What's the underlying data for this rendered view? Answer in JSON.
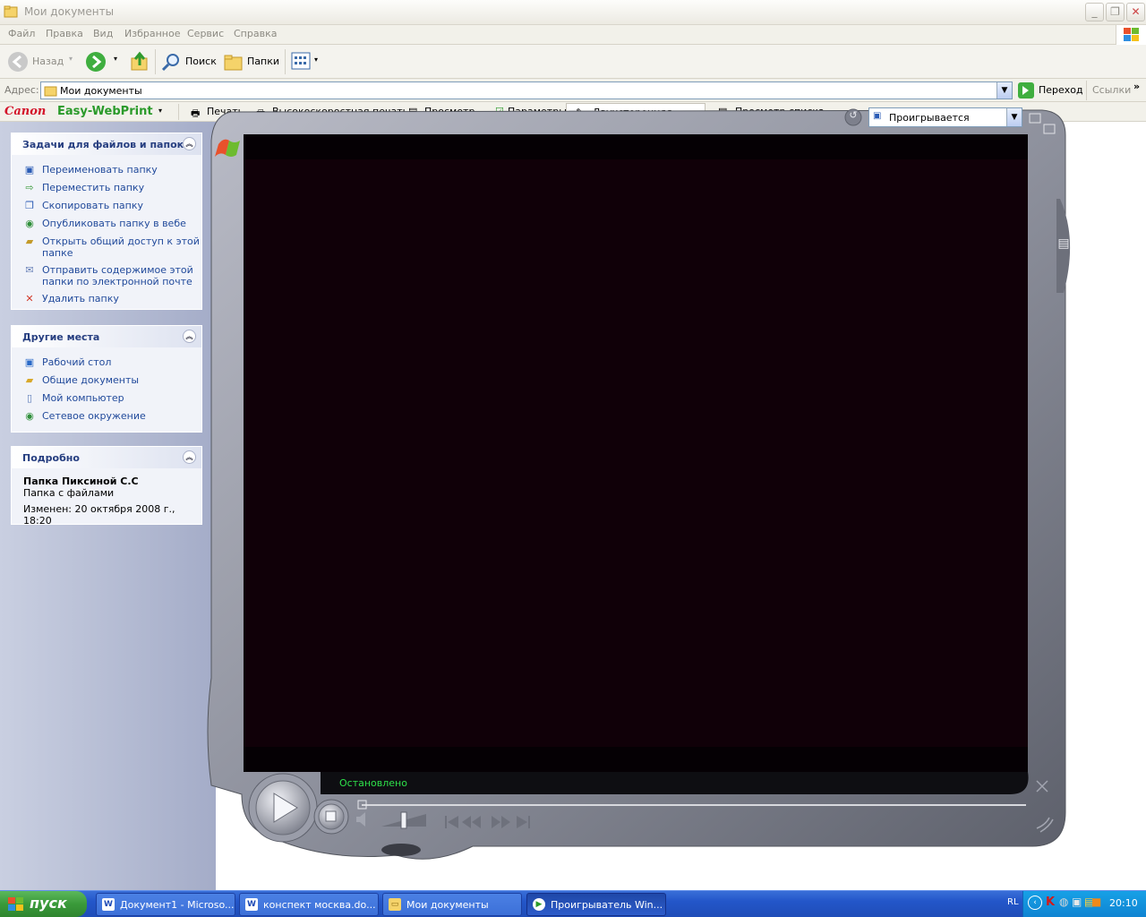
{
  "window": {
    "title": "Мои документы"
  },
  "menu": [
    "Файл",
    "Правка",
    "Вид",
    "Избранное",
    "Сервис",
    "Справка"
  ],
  "toolbar": {
    "back": "Назад",
    "search": "Поиск",
    "folders": "Папки"
  },
  "address": {
    "label": "Адрес:",
    "value": "Мои документы",
    "go": "Переход",
    "links": "Ссылки"
  },
  "canon": {
    "brand": "Canon",
    "product": "Easy-WebPrint",
    "items": [
      "Печать",
      "Высокоскоростная печать",
      "Просмотр",
      "Параметры",
      "Двухсторонняя печать",
      "Просмотр списка"
    ]
  },
  "tasks": {
    "title": "Задачи для файлов и папок",
    "items": [
      {
        "icon": "rename-icon",
        "label": "Переименовать папку"
      },
      {
        "icon": "move-icon",
        "label": "Переместить папку"
      },
      {
        "icon": "copy-icon",
        "label": "Скопировать папку"
      },
      {
        "icon": "globe-icon",
        "label": "Опубликовать папку в вебе"
      },
      {
        "icon": "share-icon",
        "label": "Открыть общий доступ к этой папке"
      },
      {
        "icon": "mail-icon",
        "label": "Отправить содержимое этой папки по электронной почте"
      },
      {
        "icon": "delete-icon",
        "label": "Удалить папку"
      }
    ]
  },
  "places": {
    "title": "Другие места",
    "items": [
      {
        "icon": "desktop-icon",
        "label": "Рабочий стол"
      },
      {
        "icon": "folder-icon",
        "label": "Общие документы"
      },
      {
        "icon": "computer-icon",
        "label": "Мой компьютер"
      },
      {
        "icon": "network-icon",
        "label": "Сетевое окружение"
      }
    ]
  },
  "details": {
    "title": "Подробно",
    "name": "Папка Пиксиной С.С",
    "type": "Папка с файлами",
    "modified": "Изменен: 20 октября 2008 г., 18:20"
  },
  "player": {
    "now_playing": "Проигрывается",
    "status": "Остановлено"
  },
  "taskbar": {
    "start": "пуск",
    "items": [
      {
        "label": "Документ1 - Microso...",
        "icon": "W",
        "active": false
      },
      {
        "label": "конспект москва.do...",
        "icon": "W",
        "active": false
      },
      {
        "label": "Мои документы",
        "icon": "▭",
        "active": false
      },
      {
        "label": "Проигрыватель Win...",
        "icon": "▶",
        "active": true
      }
    ],
    "lang": "RL",
    "clock": "20:10"
  }
}
